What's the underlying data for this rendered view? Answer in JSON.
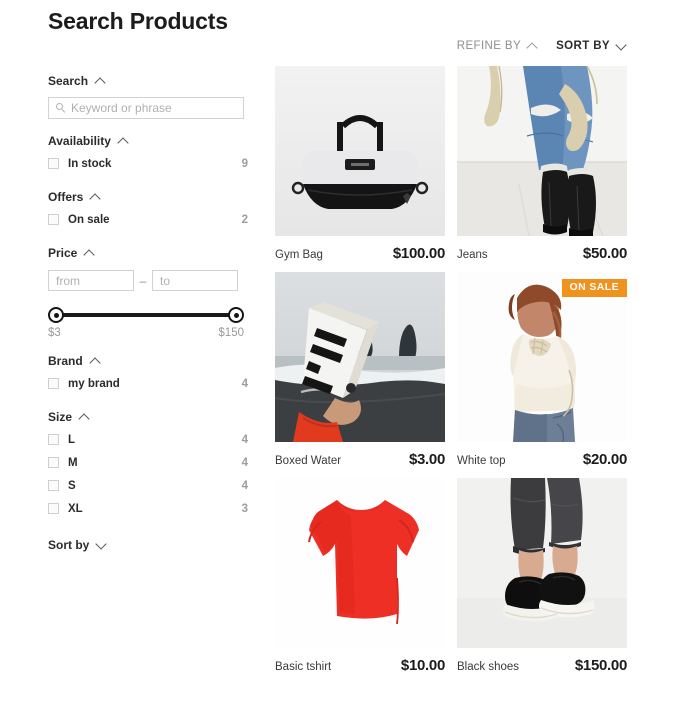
{
  "page_title": "Search Products",
  "sidebar": {
    "search": {
      "heading": "Search",
      "chevron": "chevron-up-icon",
      "placeholder": "Keyword or phrase",
      "value": ""
    },
    "availability": {
      "heading": "Availability",
      "chevron": "chevron-up-icon",
      "options": [
        {
          "label": "In stock",
          "count": "9",
          "checked": false
        }
      ]
    },
    "offers": {
      "heading": "Offers",
      "chevron": "chevron-up-icon",
      "options": [
        {
          "label": "On sale",
          "count": "2",
          "checked": false
        }
      ]
    },
    "price": {
      "heading": "Price",
      "chevron": "chevron-up-icon",
      "from_placeholder": "from",
      "to_placeholder": "to",
      "separator": "–",
      "min_label": "$3",
      "max_label": "$150"
    },
    "brand": {
      "heading": "Brand",
      "chevron": "chevron-up-icon",
      "options": [
        {
          "label": "my brand",
          "count": "4",
          "checked": false
        }
      ]
    },
    "size": {
      "heading": "Size",
      "chevron": "chevron-up-icon",
      "options": [
        {
          "label": "L",
          "count": "4",
          "checked": false
        },
        {
          "label": "M",
          "count": "4",
          "checked": false
        },
        {
          "label": "S",
          "count": "4",
          "checked": false
        },
        {
          "label": "XL",
          "count": "3",
          "checked": false
        }
      ]
    },
    "sort_by": {
      "heading": "Sort by",
      "chevron": "chevron-down-icon"
    }
  },
  "toolbar": {
    "refine_by": "REFINE BY",
    "refine_chevron": "chevron-up-icon",
    "sort_by": "SORT BY",
    "sort_chevron": "chevron-down-icon"
  },
  "badge_text": "ON SALE",
  "colors": {
    "sale_badge": "#f0921e",
    "text": "#2b2b2b",
    "muted": "#9d9d9d"
  },
  "products": [
    {
      "name": "Gym Bag",
      "price": "$100.00",
      "image": "gym-bag-photo",
      "on_sale": false
    },
    {
      "name": "Jeans",
      "price": "$50.00",
      "image": "jeans-photo",
      "on_sale": false
    },
    {
      "name": "Boxed Water",
      "price": "$3.00",
      "image": "boxed-water-photo",
      "on_sale": false
    },
    {
      "name": "White top",
      "price": "$20.00",
      "image": "white-top-photo",
      "on_sale": true
    },
    {
      "name": "Basic tshirt",
      "price": "$10.00",
      "image": "red-tshirt-photo",
      "on_sale": false
    },
    {
      "name": "Black shoes",
      "price": "$150.00",
      "image": "black-shoes-photo",
      "on_sale": false
    }
  ]
}
